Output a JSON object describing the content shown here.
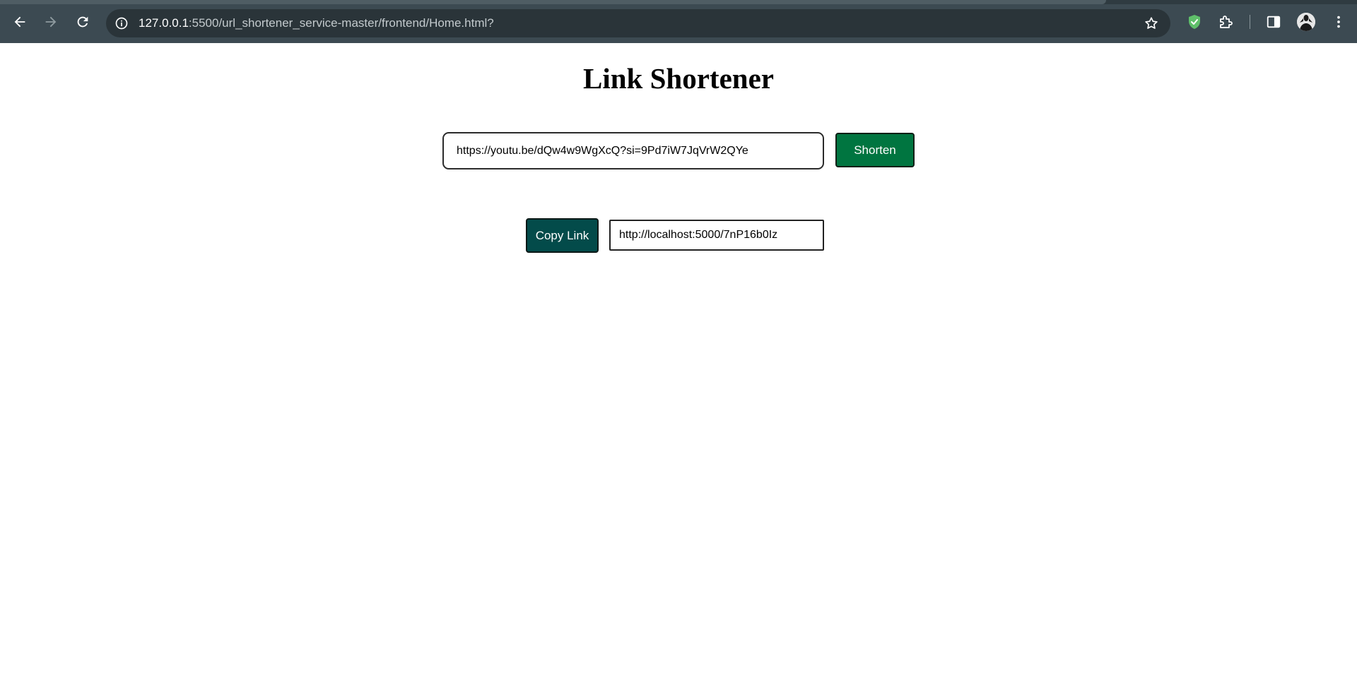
{
  "browser": {
    "url_host": "127.0.0.1",
    "url_rest": ":5500/url_shortener_service-master/frontend/Home.html?",
    "icons": {
      "back": "arrow-left-icon",
      "forward": "arrow-right-icon",
      "reload": "reload-icon",
      "site_info": "info-icon",
      "bookmark": "star-icon",
      "extension_shield": "shield-check-icon",
      "extensions": "puzzle-icon",
      "side_panel": "side-panel-icon",
      "menu": "kebab-menu-icon"
    },
    "colors": {
      "toolbar": "#3c4a52",
      "omnibox": "#2a3439",
      "shield": "#5fbf6a"
    }
  },
  "page": {
    "title": "Link Shortener",
    "long_url_input_value": "https://youtu.be/dQw4w9WgXcQ?si=9Pd7iW7JqVrW2QYe",
    "shorten_label": "Shorten",
    "copy_label": "Copy Link",
    "short_url_value": "http://localhost:5000/7nP16b0Iz",
    "colors": {
      "shorten_button": "#007540",
      "copy_button": "#034b4a"
    }
  }
}
